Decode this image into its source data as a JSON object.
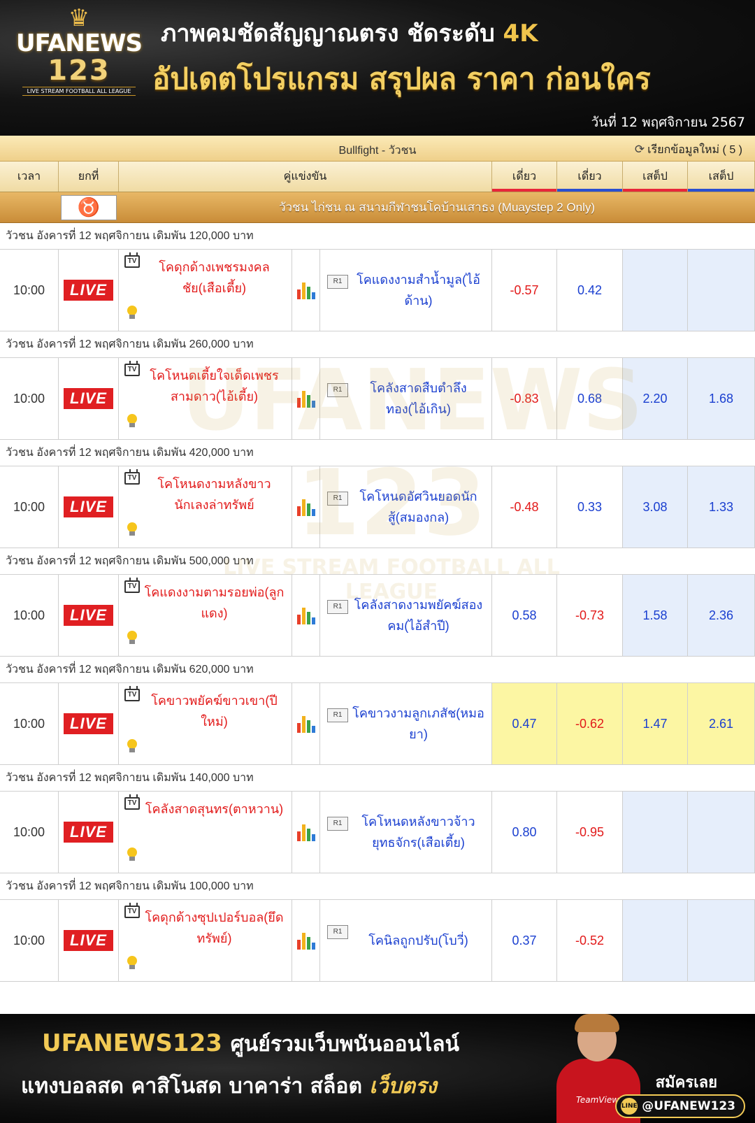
{
  "header": {
    "logo_line1": "UFANEWS",
    "logo_line2": "123",
    "logo_tagline": "LIVE STREAM FOOTBALL ALL LEAGUE",
    "headline_line1": "ภาพคมชัดสัญญาณตรง ชัดระดับ",
    "headline_line1_accent": "4K",
    "headline_line2": "อัปเดตโปรแกรม สรุปผล ราคา ก่อนใคร",
    "date": "วันที่  12 พฤศจิกายน 2567"
  },
  "table": {
    "league_title": "Bullfight - วัวชน",
    "refresh_label": "เรียกข้อมูลใหม่ ( 5 )",
    "columns": {
      "time": "เวลา",
      "round": "ยกที่",
      "match": "คู่แข่งขัน",
      "odd1": "เดี่ยว",
      "odd2": "เดี่ยว",
      "odd3": "เสต็ป",
      "odd4": "เสต็ป"
    },
    "venue": "วัวชน ไก่ชน ณ สนามกีฬาชนโคบ้านเสาธง (Muaystep 2 Only)",
    "live_label": "LIVE",
    "tv_label": "TV",
    "round_label": "R1",
    "groups": [
      {
        "title": "วัวชน อังคารที่ 12 พฤศจิกายน เดิมพัน 120,000 บาท",
        "time": "10:00",
        "home": "โคดุกด้างเพชรมงคลชัย(เสือเตี้ย)",
        "away": "โคแดงงามสำน้ำมูล(ไอ้ด้าน)",
        "o1": "-0.57",
        "o2": "0.42",
        "o3": "",
        "o4": "",
        "highlight": false
      },
      {
        "title": "วัวชน อังคารที่ 12 พฤศจิกายน เดิมพัน 260,000 บาท",
        "time": "10:00",
        "home": "โคโหนดเตี้ยใจเด็ดเพชรสามดาว(ไอ้เตี้ย)",
        "away": "โคลังสาดสืบตำลึงทอง(ไอ้เกิน)",
        "o1": "-0.83",
        "o2": "0.68",
        "o3": "2.20",
        "o4": "1.68",
        "highlight": false
      },
      {
        "title": "วัวชน อังคารที่ 12 พฤศจิกายน เดิมพัน 420,000 บาท",
        "time": "10:00",
        "home": "โคโหนดงามหลังขาวนักเลงล่าทรัพย์",
        "away": "โคโหนดอัศวินยอดนักสู้(สมองกล)",
        "o1": "-0.48",
        "o2": "0.33",
        "o3": "3.08",
        "o4": "1.33",
        "highlight": false
      },
      {
        "title": "วัวชน อังคารที่ 12 พฤศจิกายน เดิมพัน 500,000 บาท",
        "time": "10:00",
        "home": "โคแดงงามตามรอยพ่อ(ลูกแดง)",
        "away": "โคลังสาดงามพยัคฆ์สองคม(ไอ้สำปี)",
        "o1": "0.58",
        "o2": "-0.73",
        "o3": "1.58",
        "o4": "2.36",
        "highlight": false
      },
      {
        "title": "วัวชน อังคารที่ 12 พฤศจิกายน เดิมพัน 620,000 บาท",
        "time": "10:00",
        "home": "โคขาวพยัคฆ์ขาวเขา(ปีใหม่)",
        "away": "โคขาวงามลูกเภสัช(หมอยา)",
        "o1": "0.47",
        "o2": "-0.62",
        "o3": "1.47",
        "o4": "2.61",
        "highlight": true
      },
      {
        "title": "วัวชน อังคารที่ 12 พฤศจิกายน เดิมพัน 140,000 บาท",
        "time": "10:00",
        "home": "โคลังสาดสุนทร(ตาหวาน)",
        "away": "โคโหนดหลังขาวจ้าวยุทธจักร(เสือเตี้ย)",
        "o1": "0.80",
        "o2": "-0.95",
        "o3": "",
        "o4": "",
        "highlight": false
      },
      {
        "title": "วัวชน อังคารที่ 12 พฤศจิกายน เดิมพัน 100,000 บาท",
        "time": "10:00",
        "home": "โคดุกด้างซุปเปอร์บอล(ยึดทรัพย์)",
        "away": "โคนิลถูกปรับ(โบวี่)",
        "o1": "0.37",
        "o2": "-0.52",
        "o3": "",
        "o4": "",
        "highlight": false
      }
    ]
  },
  "watermark": {
    "line1": "UFANEWS",
    "line2": "123",
    "line3": "LIVE STREAM FOOTBALL ALL LEAGUE"
  },
  "footer": {
    "brand": "UFANEWS123",
    "line1_rest": "ศูนย์รวมเว็บพนันออนไลน์",
    "line2": "แทงบอลสด คาสิโนสด บาคาร่า สล็อต",
    "line2_accent": "เว็บตรง",
    "signup": "สมัครเลย",
    "line_id": "@UFANEW123",
    "line_icon_text": "LINE",
    "player_badge": "TeamViewer"
  },
  "colors": {
    "gold": "#f2ca55",
    "negative_odds": "#e21a1a",
    "positive_odds": "#1a3fd0",
    "live_badge": "#e01f22",
    "highlight_row": "#fcf6a3"
  }
}
